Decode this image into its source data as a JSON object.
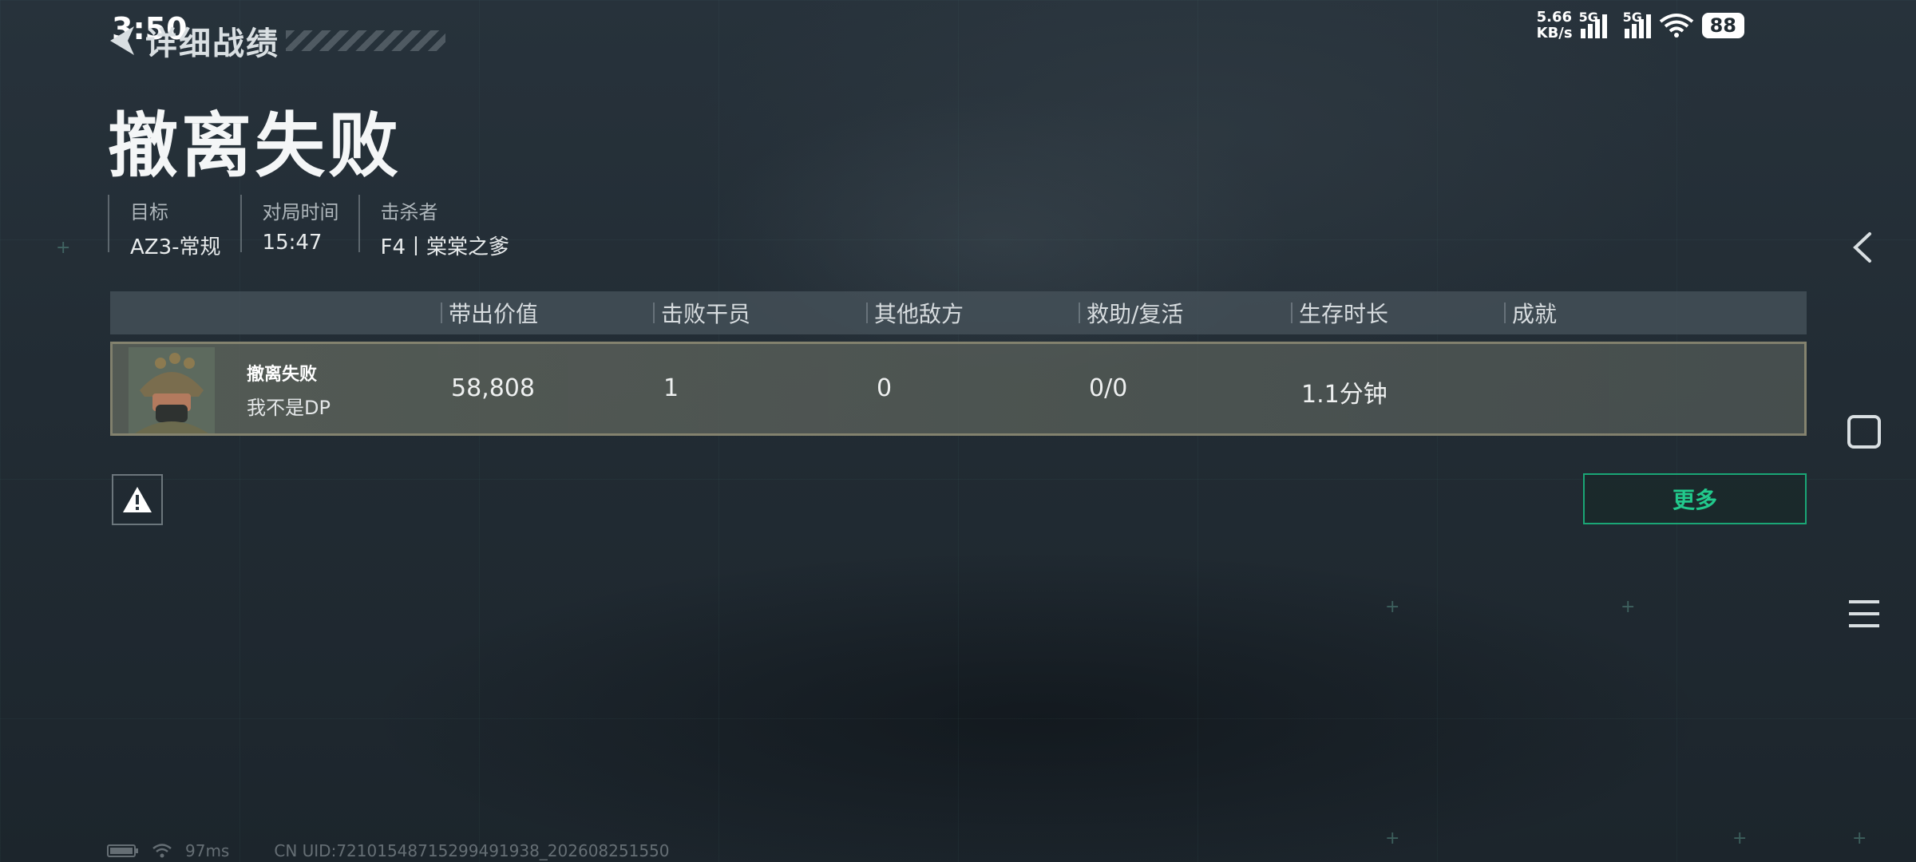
{
  "status_bar": {
    "time": "3:50",
    "net_speed_value": "5.66",
    "net_speed_unit": "KB/s",
    "signal1_label": "5G",
    "signal2_label": "5G",
    "battery": "88"
  },
  "header": {
    "back_label": "详细战绩",
    "result_title": "撤离失败"
  },
  "meta": [
    {
      "label": "目标",
      "value": "AZ3-常规"
    },
    {
      "label": "对局时间",
      "value": "15:47"
    },
    {
      "label": "击杀者",
      "value": "F4丨棠棠之爹"
    }
  ],
  "table": {
    "columns": [
      "带出价值",
      "击败干员",
      "其他敌方",
      "救助/复活",
      "生存时长",
      "成就"
    ],
    "rows": [
      {
        "status": "撤离失败",
        "player": "我不是DP",
        "values": [
          "58,808",
          "1",
          "0",
          "0/0",
          "1.1分钟",
          ""
        ]
      }
    ]
  },
  "buttons": {
    "more": "更多"
  },
  "footer": {
    "ping": "97ms",
    "uid": "CN UID:72101548715299491938_202608251550"
  },
  "icons": {
    "back": "back-arrow-icon",
    "warning": "warning-icon",
    "nav_back": "chevron-left-icon",
    "nav_home": "square-icon",
    "nav_menu": "menu-icon"
  },
  "colors": {
    "accent": "#22c98c",
    "row_border": "#968f78",
    "background": "#222c34"
  }
}
